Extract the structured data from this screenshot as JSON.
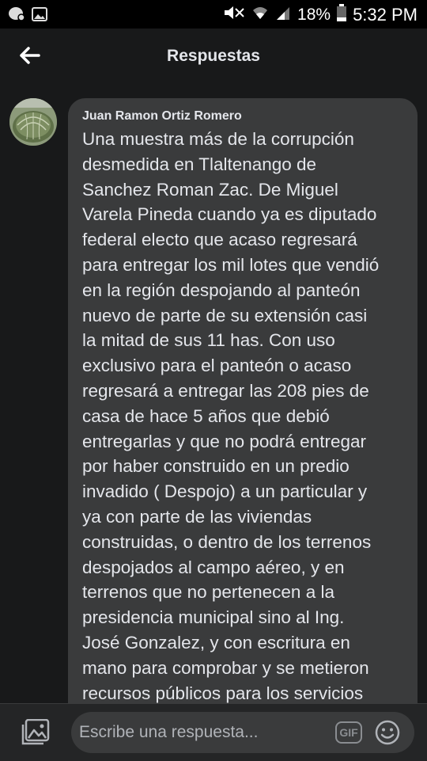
{
  "status_bar": {
    "battery_text": "18%",
    "time": "5:32 PM",
    "icons": [
      "messenger-notification-icon",
      "gallery-notification-icon",
      "mute-icon",
      "wifi-icon",
      "signal-icon",
      "battery-icon"
    ]
  },
  "header": {
    "title": "Respuestas",
    "back_icon": "arrow-left-icon"
  },
  "comment": {
    "author": "Juan Ramon Ortiz Romero",
    "text": "Una muestra más de la corrupción\ndesmedida en Tlaltenango de\nSanchez Roman Zac. De Miguel\nVarela Pineda  cuando ya es diputado\nfederal electo que acaso regresará\npara entregar los mil lotes que vendió\nen la región despojando al panteón\nnuevo de parte de su extensión casi\nla mitad de sus 11 has. Con uso\nexclusivo para el panteón o acaso\nregresará a entregar las 208 pies de\ncasa de hace 5 años que debió\nentregarlas y que no podrá entregar\npor haber construido en un predio\ninvadido ( Despojo) a un particular y\nya con parte de las viviendas\nconstruidas, o dentro de los terrenos\ndespojados al campo aéreo, y en\nterrenos que no pertenecen a la\npresidencia municipal sino al Ing.\nJosé Gonzalez, y con escritura en\nmano para comprobar y se metieron\nrecursos públicos para los servicios"
  },
  "reply_bar": {
    "placeholder": "Escribe una respuesta...",
    "gif_label": "GIF"
  },
  "colors": {
    "background": "#18191a",
    "bubble": "#3a3b3c",
    "text": "#e4e6eb",
    "muted": "#b0b3b8"
  }
}
